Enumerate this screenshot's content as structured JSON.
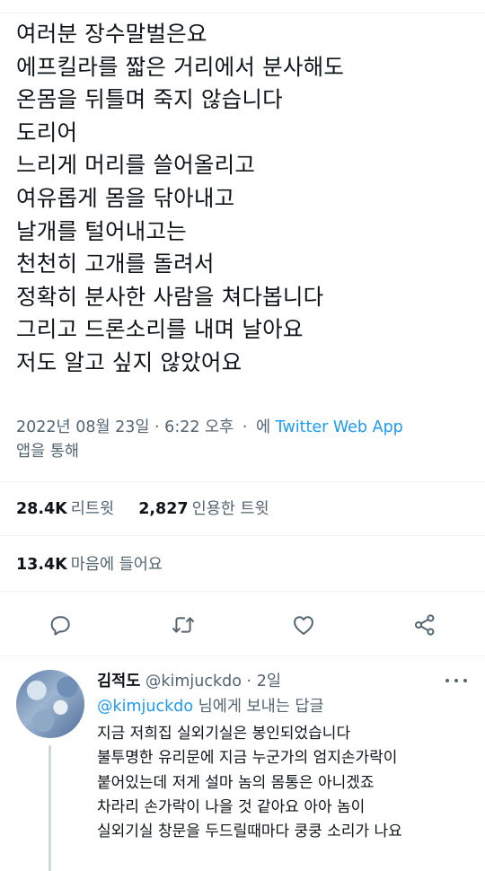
{
  "tweet": {
    "lines": [
      "여러분 장수말벌은요",
      "에프킬라를 짧은 거리에서 분사해도",
      "온몸을 뒤틀며 죽지 않습니다",
      "도리어",
      "느리게 머리를 쓸어올리고",
      "여유롭게 몸을 닦아내고",
      "날개를 털어내고는",
      "천천히 고개를 돌려서",
      "정확히 분사한 사람을 쳐다봅니다",
      "그리고 드론소리를 내며 날아요",
      "저도 알고 싶지 않았어요"
    ],
    "timestamp": "2022년 08월 23일 · 6:22 오후",
    "separator": "·",
    "via": "에",
    "source": "Twitter Web App",
    "source_suffix": "앱을 통해"
  },
  "stats": {
    "retweets_count": "28.4K",
    "retweets_label": "리트윗",
    "quotes_count": "2,827",
    "quotes_label": "인용한 트윗",
    "likes_count": "13.4K",
    "likes_label": "마음에 들어요"
  },
  "actions": [
    "reply-icon",
    "retweet-icon",
    "like-icon",
    "share-icon"
  ],
  "reply": {
    "name": "김적도",
    "handle": "@kimjuckdo",
    "dot": "·",
    "time": "2일",
    "reply_to_handle": "@kimjuckdo",
    "reply_to_suffix": " 님에게 보내는 답글",
    "lines": [
      "지금 저희집 실외기실은 봉인되었습니다",
      "불투명한 유리문에 지금 누군가의 엄지손가락이",
      "붙어있는데 저게 설마 놈의 몸통은 아니겠죠",
      "차라리 손가락이 나을 것 같아요 아아 놈이",
      "실외기실 창문을 두드릴때마다 쿵쿵 소리가 나요"
    ]
  },
  "colors": {
    "accent": "#1d9bf0",
    "text": "#0f1419",
    "secondary": "#536471",
    "divider": "#eff3f4"
  }
}
